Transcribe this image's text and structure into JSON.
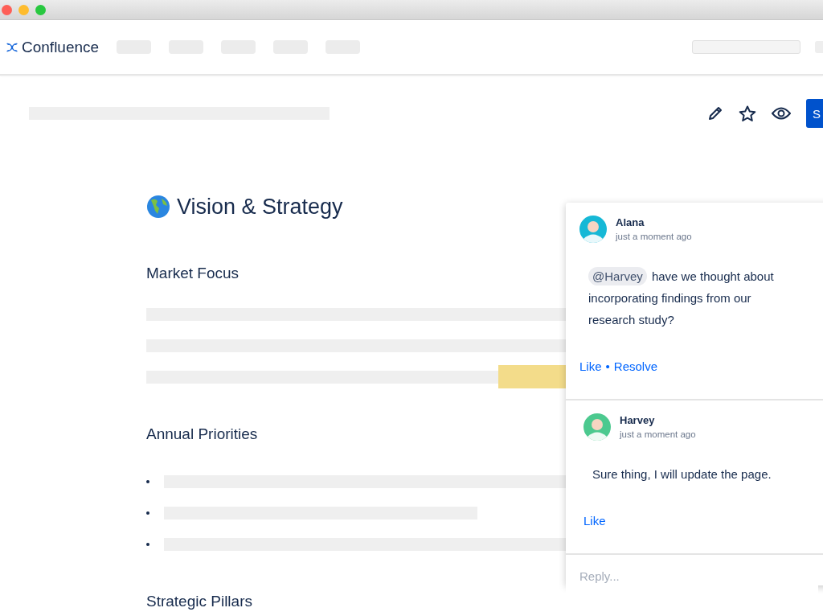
{
  "app": {
    "name": "Confluence"
  },
  "toolbar": {
    "share_button": "S"
  },
  "page": {
    "title": "Vision & Strategy",
    "sections": [
      {
        "heading": "Market Focus",
        "kind": "paragraph"
      },
      {
        "heading": "Annual Priorities",
        "kind": "bullets"
      },
      {
        "heading": "Strategic Pillars",
        "kind": "plain"
      }
    ]
  },
  "comments": [
    {
      "author": "Alana",
      "time": "just a moment ago",
      "color": "#16b8d6",
      "mention": "@Harvey",
      "body": "have we thought about incorporating findings from our research study?",
      "actions": [
        "Like",
        "Resolve"
      ]
    },
    {
      "author": "Harvey",
      "time": "just a moment ago",
      "color": "#4cc98f",
      "body": "Sure thing, I will update the page.",
      "actions": [
        "Like"
      ]
    }
  ],
  "action_separator": "•",
  "reply": {
    "placeholder": "Reply..."
  }
}
